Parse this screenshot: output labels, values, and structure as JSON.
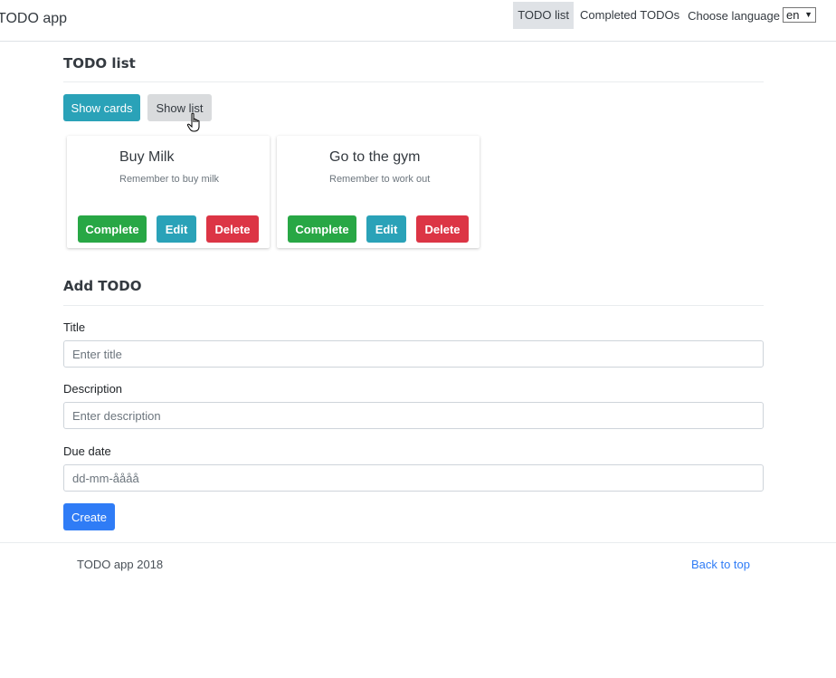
{
  "app": {
    "brand": "TODO app"
  },
  "nav": {
    "links": [
      "TODO list",
      "Completed TODOs"
    ],
    "language_label": "Choose language",
    "language_value": "en"
  },
  "todo_list": {
    "title": "TODO list",
    "show_cards": "Show cards",
    "show_list": "Show list",
    "cards": [
      {
        "title": "Buy Milk",
        "description": "Remember to buy milk"
      },
      {
        "title": "Go to the gym",
        "description": "Remember to work out"
      }
    ],
    "actions": {
      "complete": "Complete",
      "edit": "Edit",
      "delete": "Delete"
    }
  },
  "add_todo": {
    "title": "Add TODO",
    "title_label": "Title",
    "title_placeholder": "Enter title",
    "description_label": "Description",
    "description_placeholder": "Enter description",
    "due_label": "Due date",
    "due_placeholder": "dd-mm-åååå",
    "create": "Create"
  },
  "footer": {
    "copyright": "TODO app 2018",
    "back_to_top": "Back to top"
  },
  "colors": {
    "info": "#2aa2b8",
    "success": "#28a745",
    "danger": "#dc3545",
    "primary": "#2f7cf6",
    "active_nav": "#dfe2e6"
  }
}
